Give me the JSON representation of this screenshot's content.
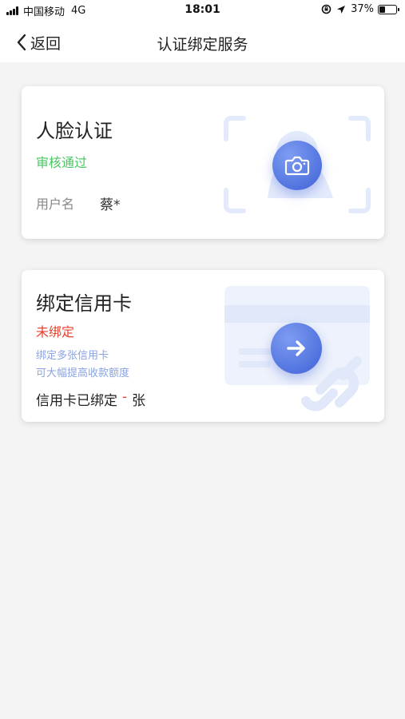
{
  "status_bar": {
    "carrier": "中国移动",
    "network": "4G",
    "time": "18:01",
    "battery_text": "37%",
    "battery_level": 0.37
  },
  "nav": {
    "back_label": "返回",
    "title": "认证绑定服务"
  },
  "face_card": {
    "title": "人脸认证",
    "status": "审核通过",
    "user_label": "用户名",
    "user_value": "蔡*",
    "icon": "camera-icon"
  },
  "credit_card": {
    "title": "绑定信用卡",
    "status": "未绑定",
    "desc_line1": "绑定多张信用卡",
    "desc_line2": "可大幅提高收款额度",
    "bound_prefix": "信用卡已绑定",
    "bound_count": "-",
    "bound_suffix": "张",
    "icon": "arrow-right-icon"
  },
  "colors": {
    "accent_blue": "#4a6fe0",
    "success_green": "#4cc764",
    "error_red": "#e8402e",
    "illustration_light": "#e6ecfb"
  }
}
